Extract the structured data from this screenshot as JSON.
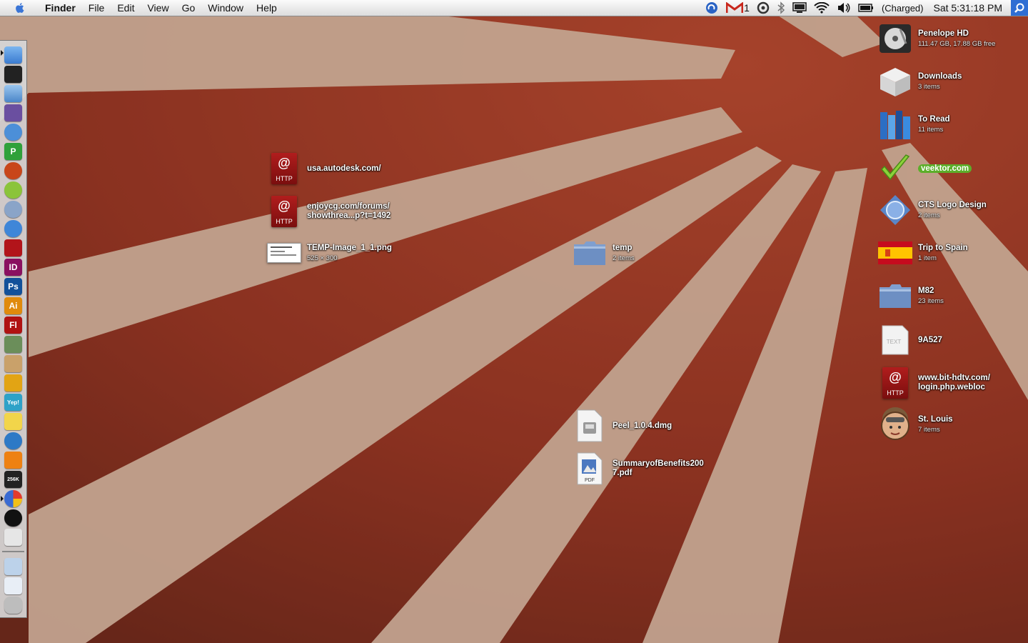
{
  "menubar": {
    "app_name": "Finder",
    "menus": [
      "File",
      "Edit",
      "View",
      "Go",
      "Window",
      "Help"
    ],
    "gmail_count": "1",
    "battery_status": "(Charged)",
    "clock": "Sat 5:31:18 PM",
    "status_icons": [
      "backup-icon",
      "gmail-icon",
      "quicksilver-icon",
      "bluetooth-icon",
      "display-icon",
      "wifi-icon",
      "volume-icon",
      "battery-icon"
    ]
  },
  "dock": {
    "apps": [
      {
        "name": "finder",
        "label": ""
      },
      {
        "name": "terminal",
        "label": ""
      },
      {
        "name": "mail",
        "label": ""
      },
      {
        "name": "wizard",
        "label": ""
      },
      {
        "name": "ichat",
        "label": ""
      },
      {
        "name": "p-app",
        "label": "P"
      },
      {
        "name": "firefox",
        "label": ""
      },
      {
        "name": "ball",
        "label": ""
      },
      {
        "name": "network",
        "label": ""
      },
      {
        "name": "itunes",
        "label": ""
      },
      {
        "name": "acrobat",
        "label": ""
      },
      {
        "name": "indesign",
        "label": "ID"
      },
      {
        "name": "photoshop",
        "label": "Ps"
      },
      {
        "name": "illustrator",
        "label": "Ai"
      },
      {
        "name": "flash",
        "label": "Fl"
      },
      {
        "name": "iphoto",
        "label": ""
      },
      {
        "name": "preview",
        "label": ""
      },
      {
        "name": "transmit",
        "label": ""
      },
      {
        "name": "yep",
        "label": "Yep!"
      },
      {
        "name": "stickies",
        "label": ""
      },
      {
        "name": "sync",
        "label": ""
      },
      {
        "name": "vlc",
        "label": ""
      },
      {
        "name": "activity",
        "label": "256K"
      },
      {
        "name": "pie",
        "label": ""
      },
      {
        "name": "camera",
        "label": ""
      },
      {
        "name": "keyboard",
        "label": ""
      }
    ],
    "tray": [
      "applications",
      "documents",
      "trash"
    ]
  },
  "desktop": {
    "left_items": [
      {
        "name": "usa.autodesk.com/",
        "sub": "",
        "kind": "webloc"
      },
      {
        "name": "enjoycg.com/forums/",
        "name2": "showthrea...p?t=1492",
        "sub": "",
        "kind": "webloc"
      },
      {
        "name": "TEMP-Image_1_1.png",
        "sub": "525 × 300",
        "kind": "image"
      }
    ],
    "center_items": [
      {
        "name": "temp",
        "sub": "2 items",
        "kind": "folder"
      },
      {
        "name": "Peel_1.0.4.dmg",
        "sub": "",
        "kind": "dmg"
      },
      {
        "name": "SummaryofBenefits200",
        "name2": "7.pdf",
        "sub": "",
        "kind": "pdf"
      }
    ],
    "right_items": [
      {
        "name": "Penelope HD",
        "sub": "111.47 GB, 17.88 GB free",
        "kind": "disk"
      },
      {
        "name": "Downloads",
        "sub": "3 items",
        "kind": "box"
      },
      {
        "name": "To Read",
        "sub": "11 items",
        "kind": "books"
      },
      {
        "name": "veektor.com",
        "sub": "",
        "kind": "check"
      },
      {
        "name": "CTS Logo Design",
        "sub": "2 items",
        "kind": "globe"
      },
      {
        "name": "Trip to Spain",
        "sub": "1 item",
        "kind": "flag"
      },
      {
        "name": "M82",
        "sub": "23 items",
        "kind": "folder"
      },
      {
        "name": "9A527",
        "sub": "",
        "kind": "text"
      },
      {
        "name": "www.bit-hdtv.com/",
        "name2": "login.php.webloc",
        "sub": "",
        "kind": "webloc"
      },
      {
        "name": "St. Louis",
        "sub": "7 items",
        "kind": "pilot"
      }
    ]
  },
  "icon_text": {
    "at": "@",
    "http": "HTTP",
    "text": "TEXT",
    "pdf": "PDF"
  },
  "colors": {
    "wallpaper_red": "#9a3a26",
    "ray": "#d8c8b0",
    "highlight_green": "#5cae2a",
    "spotlight_blue": "#2f6ed3"
  }
}
